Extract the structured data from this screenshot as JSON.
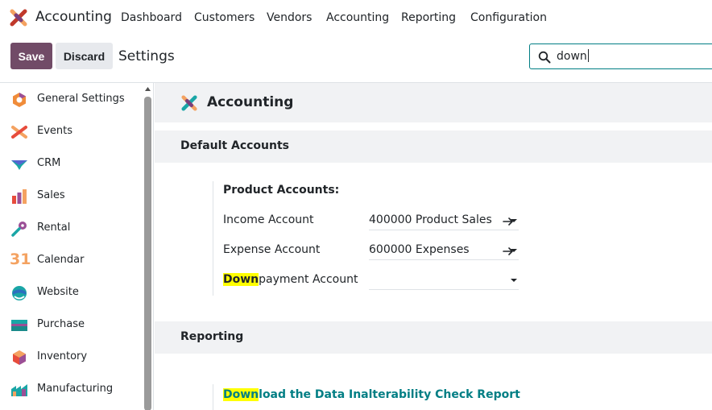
{
  "navbar": {
    "app_name": "Accounting",
    "menus": [
      "Dashboard",
      "Customers",
      "Vendors",
      "Accounting",
      "Reporting",
      "Configuration"
    ]
  },
  "control_panel": {
    "save_label": "Save",
    "discard_label": "Discard",
    "breadcrumb": "Settings"
  },
  "search": {
    "value": "down",
    "icon": "search-icon"
  },
  "sidebar": {
    "items": [
      {
        "label": "General Settings",
        "icon": "general-settings-icon"
      },
      {
        "label": "Events",
        "icon": "events-icon"
      },
      {
        "label": "CRM",
        "icon": "crm-icon"
      },
      {
        "label": "Sales",
        "icon": "sales-icon"
      },
      {
        "label": "Rental",
        "icon": "rental-icon"
      },
      {
        "label": "Calendar",
        "icon": "calendar-icon",
        "icon_text": "31"
      },
      {
        "label": "Website",
        "icon": "website-icon"
      },
      {
        "label": "Purchase",
        "icon": "purchase-icon"
      },
      {
        "label": "Inventory",
        "icon": "inventory-icon"
      },
      {
        "label": "Manufacturing",
        "icon": "manufacturing-icon"
      }
    ]
  },
  "main": {
    "app_title": "Accounting",
    "default_accounts": {
      "title": "Default Accounts",
      "product_accounts_label": "Product Accounts:",
      "income_label": "Income Account",
      "income_value": "400000 Product Sales",
      "expense_label": "Expense Account",
      "expense_value": "600000 Expenses",
      "downpayment_highlight": "Down",
      "downpayment_rest": "payment Account",
      "downpayment_value": ""
    },
    "reporting": {
      "title": "Reporting",
      "link_highlight": "Down",
      "link_rest": "load the Data Inalterability Check Report"
    }
  },
  "colors": {
    "primary": "#714b67",
    "accent": "#017e84",
    "highlight": "#ffff00",
    "section_bg": "#f1f2f4"
  }
}
